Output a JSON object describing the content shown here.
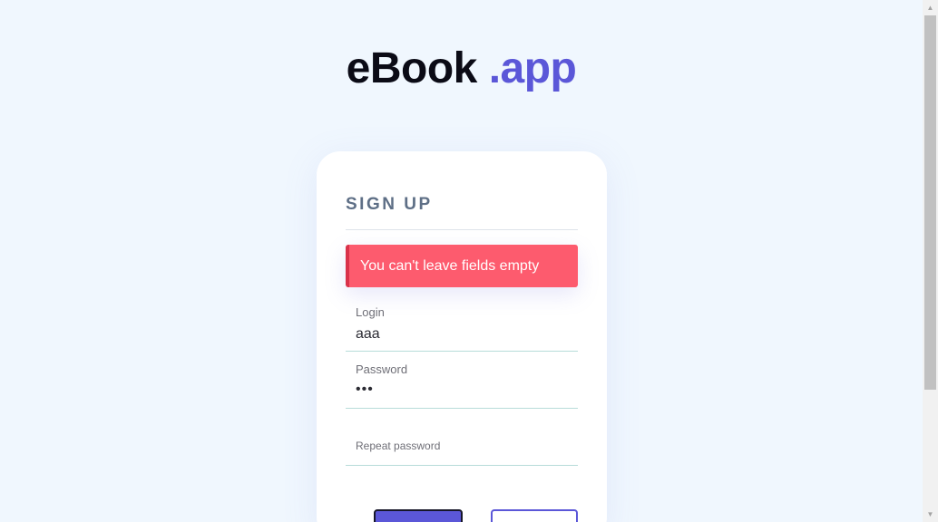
{
  "brand": {
    "part1": "eBook",
    "part2": ".app"
  },
  "signup": {
    "title": "SIGN UP",
    "error": "You can't leave fields empty",
    "fields": {
      "login": {
        "label": "Login",
        "value": "aaa"
      },
      "password": {
        "label": "Password",
        "value": "•••"
      },
      "repeat_password": {
        "label": "Repeat password",
        "value": ""
      }
    }
  },
  "colors": {
    "background": "#f0f7fe",
    "accent": "#5b57d8",
    "error": "#fd5b6e"
  },
  "scrollbar": {
    "up_arrow": "▲",
    "down_arrow": "▼"
  }
}
